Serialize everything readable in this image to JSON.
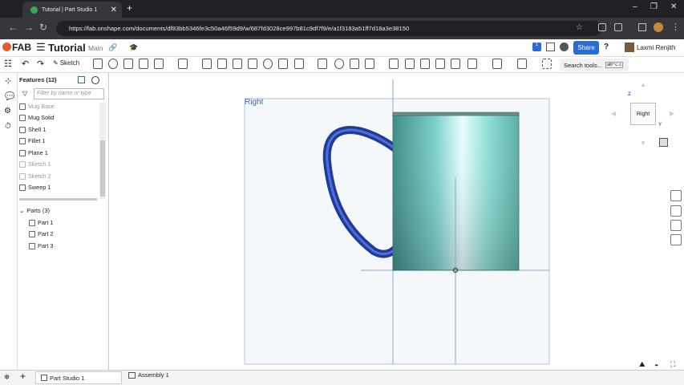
{
  "browser": {
    "tab_title": "Tutorial | Part Studio 1",
    "url": "https://fab.onshape.com/documents/df83bb5346fe3c50a46f59d9/w/687fd3028ce997b81c9df7f9/e/a1f3183a51ff7d18a3e38150",
    "min": "–",
    "max": "❐",
    "close": "✕",
    "new_tab": "+"
  },
  "header": {
    "logo": "FAB",
    "doc_title": "Tutorial",
    "branch": "Main",
    "share": "Share",
    "user": "Laxmi Renjith",
    "notif_count": "1"
  },
  "toolbar": {
    "sketch": "Sketch",
    "search": "Search tools...",
    "shortcut": "alt/⌥ c"
  },
  "features": {
    "title": "Features (12)",
    "filter_placeholder": "Filter by name or type",
    "items": [
      {
        "label": "Mug Base",
        "dim": true
      },
      {
        "label": "Mug Solid",
        "dim": false
      },
      {
        "label": "Shell 1",
        "dim": false
      },
      {
        "label": "Fillet 1",
        "dim": false
      },
      {
        "label": "Plane 1",
        "dim": false
      },
      {
        "label": "Sketch 1",
        "dim": true
      },
      {
        "label": "Sketch 2",
        "dim": true
      },
      {
        "label": "Sweep 1",
        "dim": false
      }
    ],
    "parts_title": "Parts (3)",
    "parts": [
      "Part 1",
      "Part 2",
      "Part 3"
    ]
  },
  "viewport": {
    "plane_label": "Right",
    "cube_label": "Right",
    "axis_z": "Z",
    "axis_y": "Y"
  },
  "bottom": {
    "tab1": "Part Studio 1",
    "tab2": "Assembly 1",
    "add": "+"
  }
}
